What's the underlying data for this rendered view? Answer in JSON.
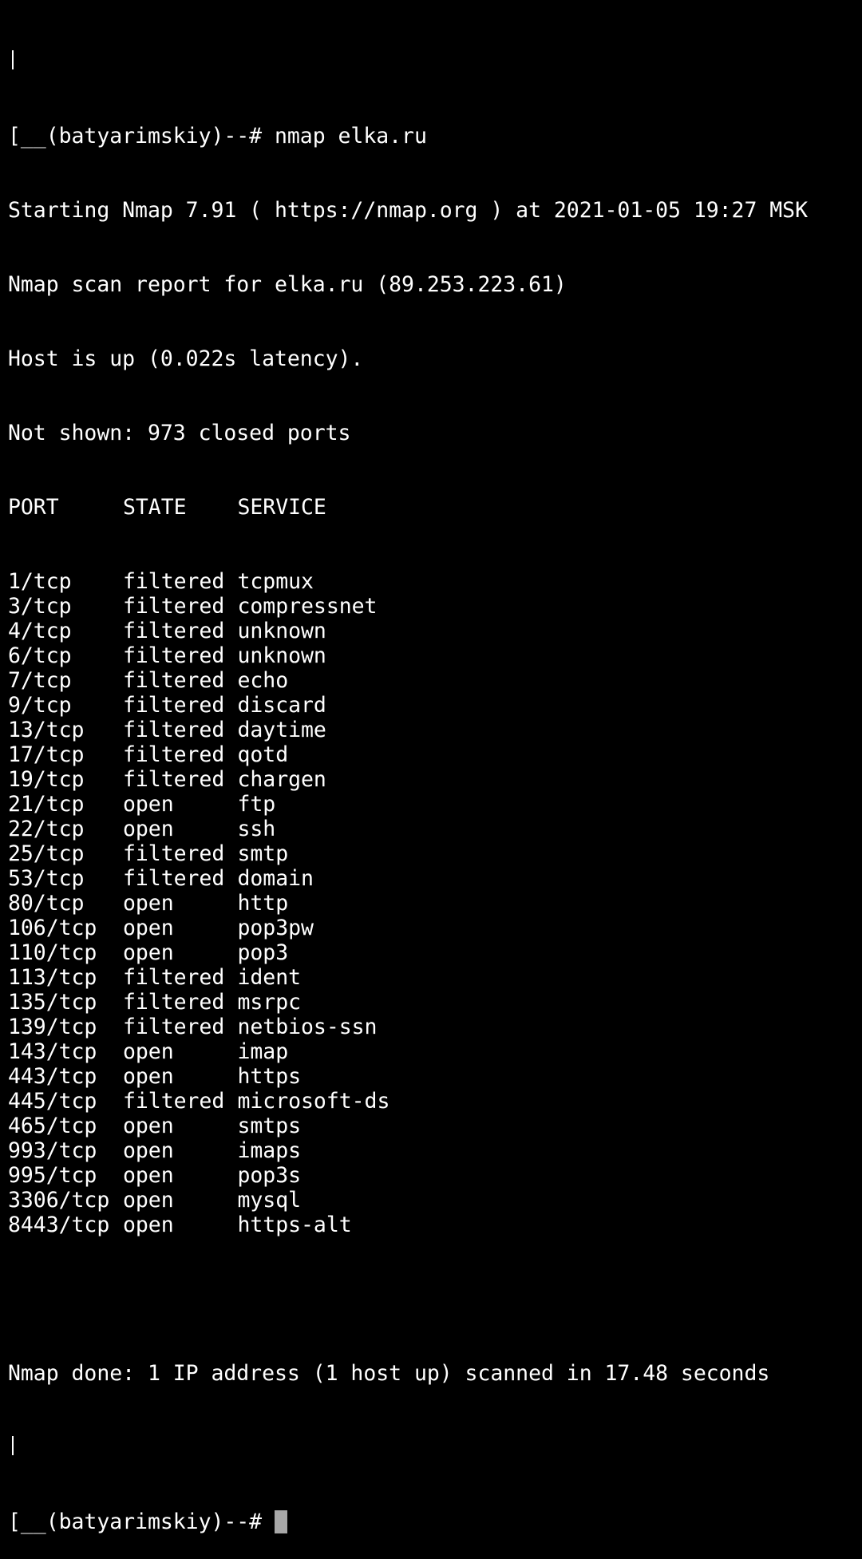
{
  "terminal": {
    "background": "#000000",
    "foreground": "#ffffff",
    "cursor_color": "#a8a8a8",
    "prompt": "[__(batyarimskiy)--# ",
    "command": "nmap elka.ru",
    "output": {
      "starting": "Starting Nmap 7.91 ( https://nmap.org ) at 2021-01-05 19:27 MSK",
      "report": "Nmap scan report for elka.ru (89.253.223.61)",
      "host_status": "Host is up (0.022s latency).",
      "not_shown": "Not shown: 973 closed ports",
      "table_headers": {
        "port": "PORT",
        "state": "STATE",
        "service": "SERVICE"
      },
      "ports": [
        {
          "port": "1/tcp",
          "state": "filtered",
          "service": "tcpmux"
        },
        {
          "port": "3/tcp",
          "state": "filtered",
          "service": "compressnet"
        },
        {
          "port": "4/tcp",
          "state": "filtered",
          "service": "unknown"
        },
        {
          "port": "6/tcp",
          "state": "filtered",
          "service": "unknown"
        },
        {
          "port": "7/tcp",
          "state": "filtered",
          "service": "echo"
        },
        {
          "port": "9/tcp",
          "state": "filtered",
          "service": "discard"
        },
        {
          "port": "13/tcp",
          "state": "filtered",
          "service": "daytime"
        },
        {
          "port": "17/tcp",
          "state": "filtered",
          "service": "qotd"
        },
        {
          "port": "19/tcp",
          "state": "filtered",
          "service": "chargen"
        },
        {
          "port": "21/tcp",
          "state": "open",
          "service": "ftp"
        },
        {
          "port": "22/tcp",
          "state": "open",
          "service": "ssh"
        },
        {
          "port": "25/tcp",
          "state": "filtered",
          "service": "smtp"
        },
        {
          "port": "53/tcp",
          "state": "filtered",
          "service": "domain"
        },
        {
          "port": "80/tcp",
          "state": "open",
          "service": "http"
        },
        {
          "port": "106/tcp",
          "state": "open",
          "service": "pop3pw"
        },
        {
          "port": "110/tcp",
          "state": "open",
          "service": "pop3"
        },
        {
          "port": "113/tcp",
          "state": "filtered",
          "service": "ident"
        },
        {
          "port": "135/tcp",
          "state": "filtered",
          "service": "msrpc"
        },
        {
          "port": "139/tcp",
          "state": "filtered",
          "service": "netbios-ssn"
        },
        {
          "port": "143/tcp",
          "state": "open",
          "service": "imap"
        },
        {
          "port": "443/tcp",
          "state": "open",
          "service": "https"
        },
        {
          "port": "445/tcp",
          "state": "filtered",
          "service": "microsoft-ds"
        },
        {
          "port": "465/tcp",
          "state": "open",
          "service": "smtps"
        },
        {
          "port": "993/tcp",
          "state": "open",
          "service": "imaps"
        },
        {
          "port": "995/tcp",
          "state": "open",
          "service": "pop3s"
        },
        {
          "port": "3306/tcp",
          "state": "open",
          "service": "mysql"
        },
        {
          "port": "8443/tcp",
          "state": "open",
          "service": "https-alt"
        }
      ],
      "done": "Nmap done: 1 IP address (1 host up) scanned in 17.48 seconds"
    },
    "final_prompt": "[__(batyarimskiy)--# "
  }
}
